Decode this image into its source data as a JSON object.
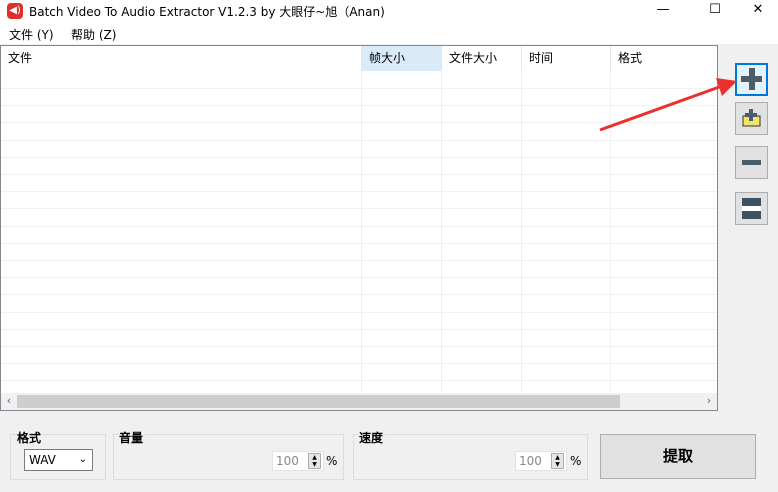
{
  "window": {
    "title": "Batch Video To Audio Extractor V1.2.3 by 大眼仔~旭（Anan)",
    "minimize": "—",
    "maximize": "☐",
    "close": "✕"
  },
  "menu": [
    "文件 (Y)",
    "帮助 (Z)"
  ],
  "columns": [
    "文件",
    "帧大小",
    "文件大小",
    "时间",
    "格式"
  ],
  "scroll": {
    "left": "‹",
    "right": "›"
  },
  "sidebar": {
    "add": "add-file",
    "add_folder": "add-folder",
    "remove": "remove",
    "clear": "clear"
  },
  "format": {
    "label": "格式",
    "value": "WAV"
  },
  "volume": {
    "label": "音量",
    "value": "100",
    "unit": "%"
  },
  "speed": {
    "label": "速度",
    "value": "100",
    "unit": "%"
  },
  "extract_label": "提取",
  "colors": {
    "header_selected": "#d9ebf9",
    "arrow": "#e8322b",
    "focus": "#0078d7"
  }
}
